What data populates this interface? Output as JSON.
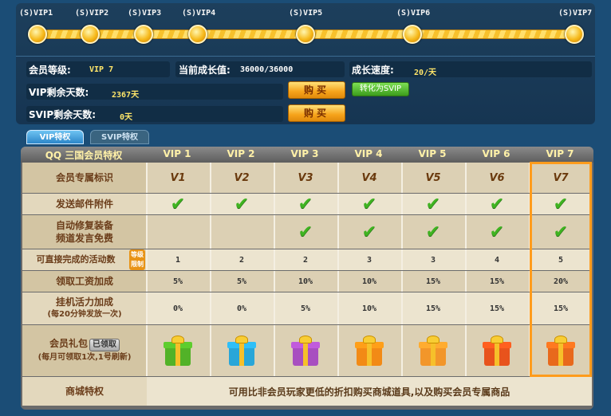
{
  "progress": {
    "levels": [
      "(S)VIP1",
      "(S)VIP2",
      "(S)VIP3",
      "(S)VIP4",
      "(S)VIP5",
      "(S)VIP6",
      "(S)VIP7"
    ]
  },
  "info": {
    "member_level_label": "会员等级:",
    "member_level_value": "VIP 7",
    "growth_label": "当前成长值:",
    "growth_value": "36000/36000",
    "speed_label": "成长速度:",
    "speed_value": "20/天",
    "vip_days_label": "VIP剩余天数:",
    "vip_days_value": "2367天",
    "svip_days_label": "SVIP剩余天数:",
    "svip_days_value": "0天",
    "buy_label": "购买",
    "convert_label": "转化为SVIP"
  },
  "tabs": {
    "vip": "VIP特权",
    "svip": "SVIP特权"
  },
  "table": {
    "corner": "QQ 三国会员特权",
    "columns": [
      "VIP 1",
      "VIP 2",
      "VIP 3",
      "VIP 4",
      "VIP 5",
      "VIP 6",
      "VIP 7"
    ],
    "rows": {
      "badge": {
        "label": "会员专属标识",
        "values": [
          "V1",
          "V2",
          "V3",
          "V4",
          "V5",
          "V6",
          "V7"
        ]
      },
      "mail": {
        "label": "发送邮件附件"
      },
      "repair": {
        "label1": "自动修复装备",
        "label2": "频道发言免费"
      },
      "activity": {
        "label": "可直接完成的活动数",
        "tag": "等级限制",
        "values": [
          "1",
          "2",
          "2",
          "3",
          "3",
          "4",
          "5"
        ]
      },
      "salary": {
        "label": "领取工资加成",
        "values": [
          "5%",
          "5%",
          "10%",
          "10%",
          "15%",
          "15%",
          "20%"
        ]
      },
      "idle": {
        "label": "挂机活力加成",
        "sub": "(每20分钟发放一次)",
        "values": [
          "0%",
          "0%",
          "5%",
          "10%",
          "15%",
          "15%",
          "15%"
        ]
      },
      "gift": {
        "label": "会员礼包",
        "claimed": "已领取",
        "sub": "(每月可领取1次,1号刷新)"
      },
      "shop": {
        "label": "商城特权",
        "text": "可用比非会员玩家更低的折扣购买商城道具,以及购买会员专属商品"
      }
    }
  },
  "colors": {
    "gift_box": [
      "#52b228",
      "#29a6d8",
      "#a84fc0",
      "#f28a16",
      "#f2962a",
      "#e8531c",
      "#e8691c"
    ]
  }
}
